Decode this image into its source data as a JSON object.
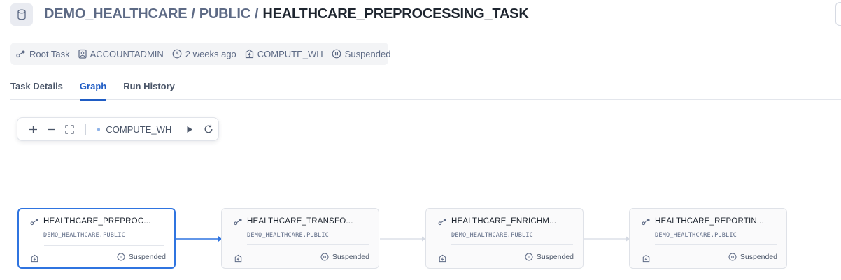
{
  "header": {
    "db_icon": "database-icon",
    "breadcrumb_db": "DEMO_HEALTHCARE",
    "breadcrumb_schema": "PUBLIC",
    "breadcrumb_sep": "/",
    "task_name": "HEALTHCARE_PREPROCESSING_TASK"
  },
  "meta": {
    "type": "Root Task",
    "owner": "ACCOUNTADMIN",
    "modified": "2 weeks ago",
    "warehouse": "COMPUTE_WH",
    "state": "Suspended"
  },
  "tabs": [
    {
      "label": "Task Details"
    },
    {
      "label": "Graph"
    },
    {
      "label": "Run History"
    }
  ],
  "active_tab": "Graph",
  "toolbar": {
    "warehouse": "COMPUTE_WH",
    "icons": [
      "zoom-in-icon",
      "zoom-out-icon",
      "fit-view-icon",
      "run-icon",
      "refresh-icon"
    ]
  },
  "graph": {
    "nodes": [
      {
        "name": "HEALTHCARE_PREPROC...",
        "schema": "DEMO_HEALTHCARE.PUBLIC",
        "status": "Suspended",
        "selected": true
      },
      {
        "name": "HEALTHCARE_TRANSFO...",
        "schema": "DEMO_HEALTHCARE.PUBLIC",
        "status": "Suspended",
        "selected": false
      },
      {
        "name": "HEALTHCARE_ENRICHM...",
        "schema": "DEMO_HEALTHCARE.PUBLIC",
        "status": "Suspended",
        "selected": false
      },
      {
        "name": "HEALTHCARE_REPORTIN...",
        "schema": "DEMO_HEALTHCARE.PUBLIC",
        "status": "Suspended",
        "selected": false
      }
    ]
  },
  "colors": {
    "accent": "#2f74e0",
    "tab_active": "#1f5cc4",
    "edge_inactive": "#d5dae3"
  }
}
